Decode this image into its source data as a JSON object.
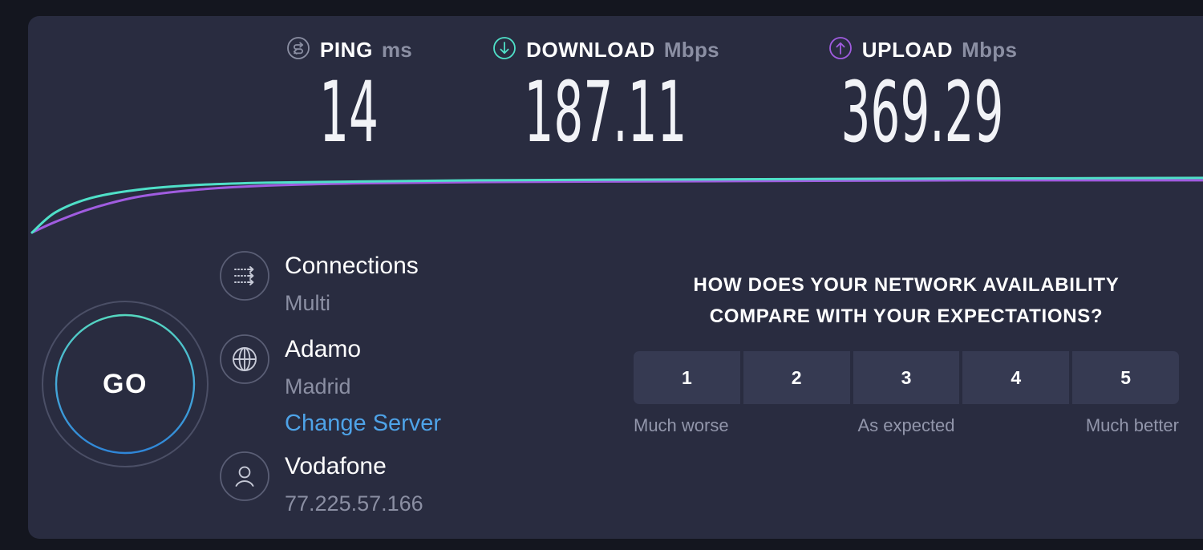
{
  "colors": {
    "page_background": "#14161f",
    "card_background": "#292c40",
    "download_accent": "#4fe0c8",
    "upload_accent": "#a05ce0",
    "ping_accent": "#8b8fa3",
    "link_blue": "#4ea3e8",
    "survey_button": "#363a52",
    "muted_text": "#8b8fa3"
  },
  "stats": [
    {
      "id": "ping",
      "icon": "ping-icon",
      "label": "PING",
      "unit": "ms",
      "value": "14",
      "accent": "#8b8fa3"
    },
    {
      "id": "download",
      "icon": "download-arrow-icon",
      "label": "DOWNLOAD",
      "unit": "Mbps",
      "value": "187.11",
      "accent": "#4fe0c8"
    },
    {
      "id": "upload",
      "icon": "upload-arrow-icon",
      "label": "UPLOAD",
      "unit": "Mbps",
      "value": "369.29",
      "accent": "#a05ce0"
    }
  ],
  "go_button": {
    "label": "GO"
  },
  "connection_info": {
    "connections": {
      "icon": "multi-connections-icon",
      "title": "Connections",
      "detail": "Multi"
    },
    "server": {
      "icon": "globe-icon",
      "title": "Adamo",
      "detail": "Madrid",
      "change_link": "Change Server"
    },
    "isp": {
      "icon": "person-icon",
      "title": "Vodafone",
      "detail": "77.225.57.166"
    }
  },
  "survey": {
    "question_line1": "HOW DOES YOUR NETWORK AVAILABILITY",
    "question_line2": "COMPARE WITH YOUR EXPECTATIONS?",
    "options": [
      "1",
      "2",
      "3",
      "4",
      "5"
    ],
    "scale_low": "Much worse",
    "scale_mid": "As expected",
    "scale_high": "Much better"
  },
  "chart_data": {
    "type": "line",
    "title": "",
    "xlabel": "",
    "ylabel": "",
    "grid": false,
    "legend": "none",
    "series": [
      {
        "name": "Download",
        "color": "#4fe0c8",
        "x": [
          0,
          2,
          5,
          9,
          14,
          20,
          28,
          38,
          50,
          65,
          80,
          100
        ],
        "y": [
          0,
          34,
          58,
          72,
          80,
          84,
          86,
          88,
          89,
          90,
          91,
          92
        ]
      },
      {
        "name": "Upload",
        "color": "#a05ce0",
        "x": [
          0,
          2,
          5,
          9,
          14,
          20,
          28,
          38,
          50,
          65,
          80,
          100
        ],
        "y": [
          0,
          18,
          40,
          60,
          72,
          79,
          83,
          85,
          86,
          87,
          88,
          88
        ]
      }
    ],
    "xlim": [
      0,
      100
    ],
    "ylim": [
      0,
      100
    ]
  }
}
